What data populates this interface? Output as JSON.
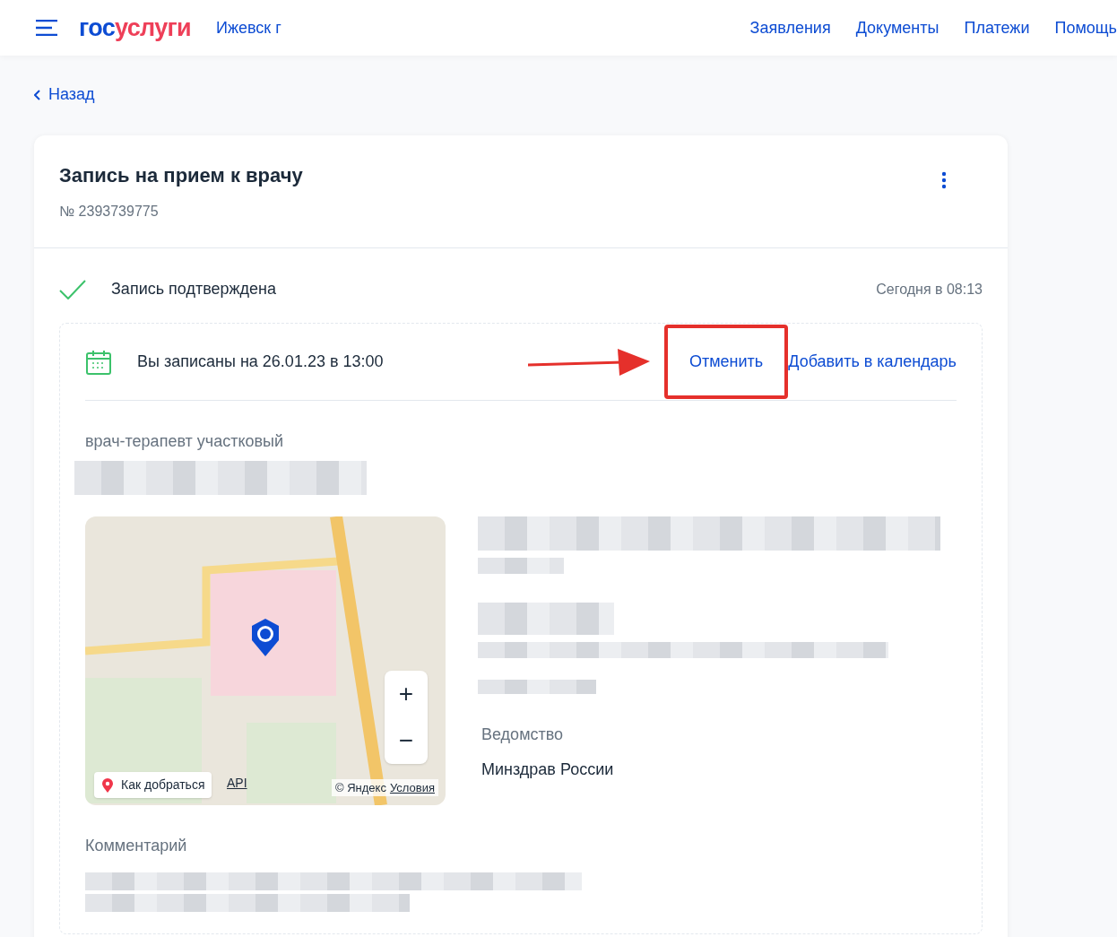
{
  "header": {
    "logo": {
      "first": "гос",
      "second": "услуги"
    },
    "city": "Ижевск г",
    "nav": [
      "Заявления",
      "Документы",
      "Платежи",
      "Помощь"
    ]
  },
  "back": "Назад",
  "card": {
    "title": "Запись на прием к врачу",
    "number": "№ 2393739775",
    "status": {
      "text": "Запись подтверждена",
      "time": "Сегодня в 08:13"
    },
    "appointment": {
      "text": "Вы записаны на 26.01.23 в 13:00",
      "actions": [
        {
          "label": "Отменить",
          "highlighted": true
        },
        {
          "label": "Добавить в календарь",
          "highlighted": false
        }
      ]
    },
    "doctor": "врач-терапевт участковый",
    "map": {
      "route": "Как добраться",
      "api": "API",
      "copyright": "© Яндекс",
      "terms": "Условия",
      "zoom_in": "+",
      "zoom_out": "−"
    },
    "department": {
      "label": "Ведомство",
      "value": "Минздрав России"
    },
    "comment_label": "Комментарий"
  }
}
